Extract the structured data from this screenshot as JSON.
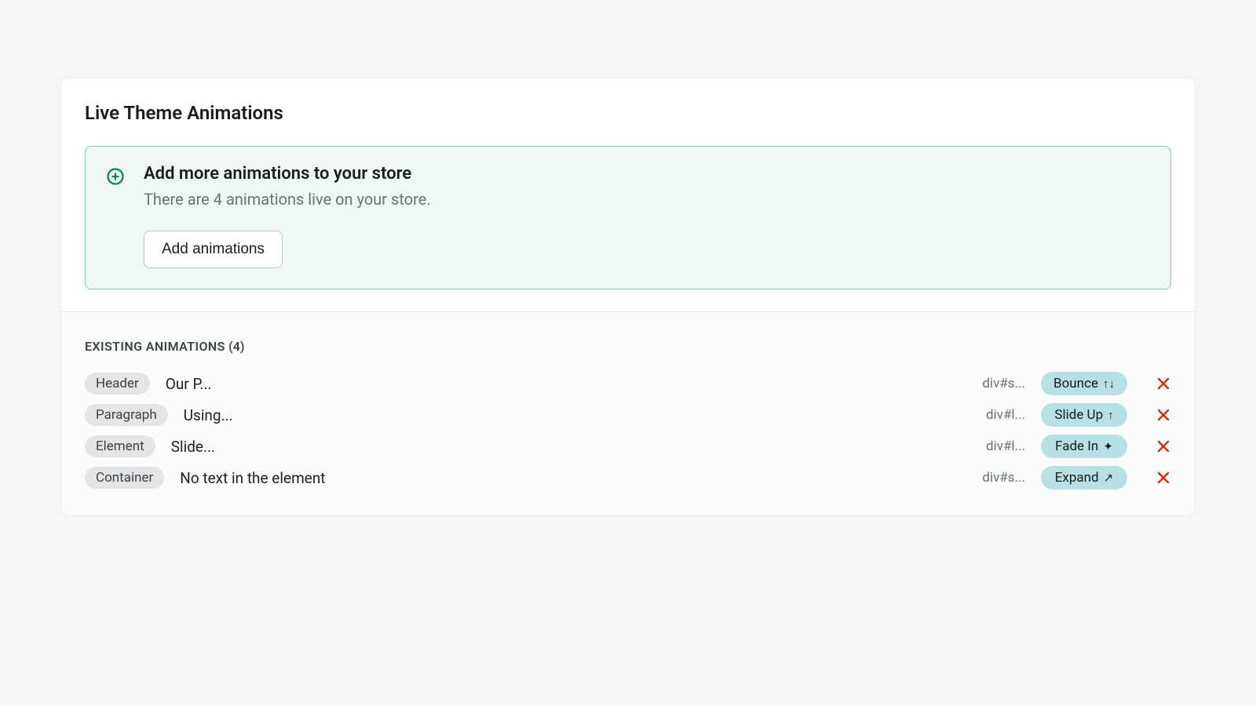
{
  "title": "Live Theme Animations",
  "banner": {
    "heading": "Add more animations to your store",
    "subtext": "There are 4 animations live on your store.",
    "button_label": "Add animations"
  },
  "section": {
    "label": "EXISTING ANIMATIONS",
    "count": "(4)"
  },
  "rows": [
    {
      "tag": "Header",
      "content": "Our P...",
      "selector": "div#s...",
      "anim_name": "Bounce",
      "anim_glyph": "↑↓"
    },
    {
      "tag": "Paragraph",
      "content": "Using...",
      "selector": "div#l...",
      "anim_name": "Slide Up",
      "anim_glyph": "↑"
    },
    {
      "tag": "Element",
      "content": "Slide...",
      "selector": "div#l...",
      "anim_name": "Fade In",
      "anim_glyph": "✦"
    },
    {
      "tag": "Container",
      "content": "No text in the element",
      "selector": "div#s...",
      "anim_name": "Expand",
      "anim_glyph": "↗"
    }
  ],
  "colors": {
    "accent_green": "#008060",
    "pill_bg": "#b6e0e4",
    "delete_red": "#d82c0d"
  }
}
